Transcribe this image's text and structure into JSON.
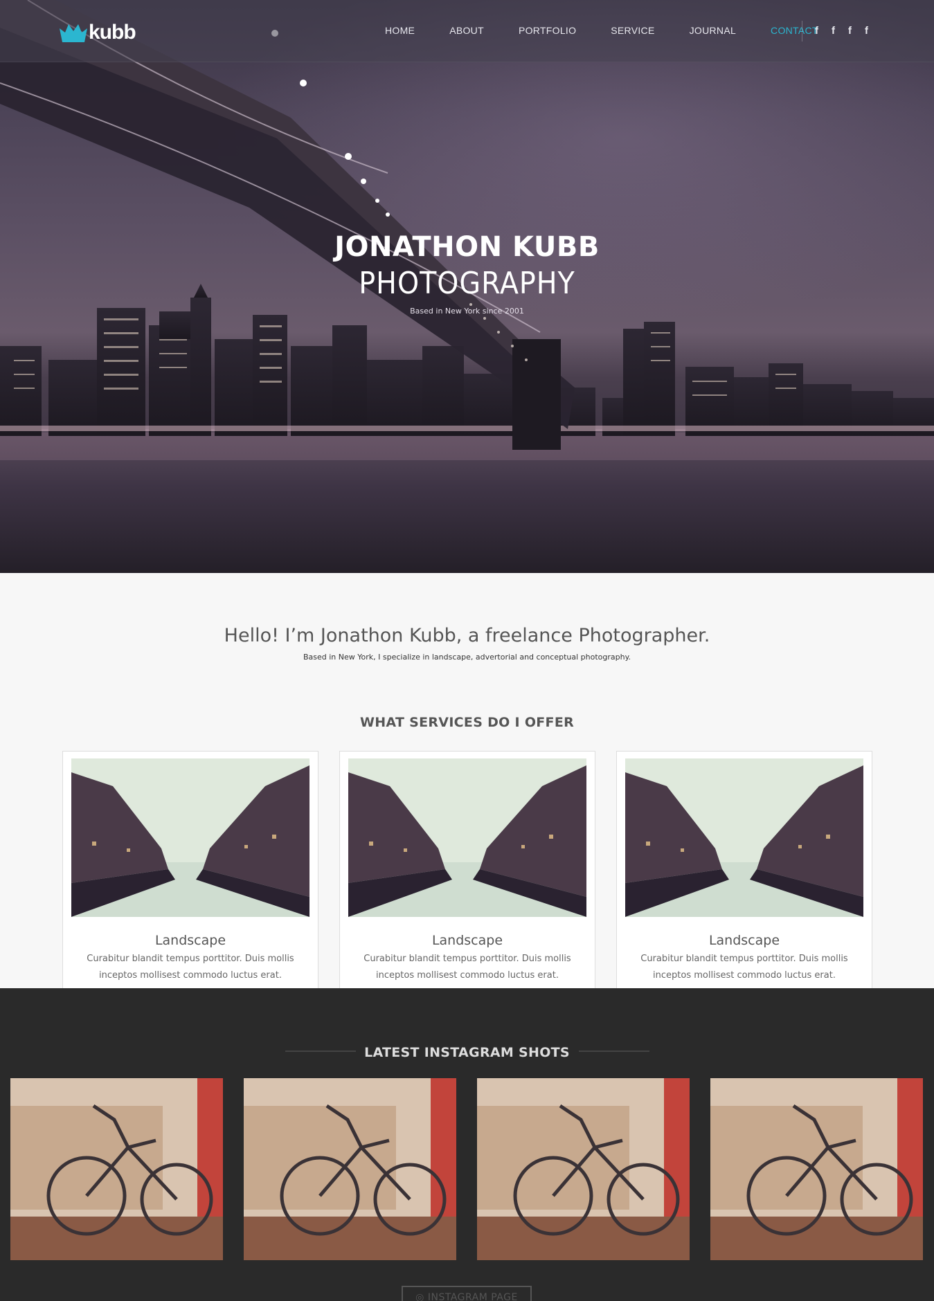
{
  "brand": {
    "logo_text": "kubb",
    "accent": "#2bb6d0"
  },
  "nav": {
    "items": [
      {
        "label": "HOME"
      },
      {
        "label": "ABOUT"
      },
      {
        "label": "PORTFOLIO"
      },
      {
        "label": "SERVICE"
      },
      {
        "label": "JOURNAL"
      },
      {
        "label": "CONTACT",
        "active": true
      }
    ],
    "socials": [
      "f",
      "f",
      "f",
      "f"
    ]
  },
  "hero": {
    "title": "JONATHON KUBB",
    "subtitle": "PHOTOGRAPHY",
    "tagline": "Based in New York since 2001"
  },
  "intro": {
    "heading": "Hello! I’m Jonathon Kubb, a freelance Photographer.",
    "text": "Based in New York, I specialize in landscape, advertorial and conceptual photography."
  },
  "services": {
    "title": "WHAT SERVICES DO I OFFER",
    "cards": [
      {
        "title": "Landscape",
        "text": "Curabitur blandit tempus porttitor. Duis mollis inceptos mollisest commodo luctus erat."
      },
      {
        "title": "Landscape",
        "text": "Curabitur blandit tempus porttitor. Duis mollis inceptos mollisest commodo luctus erat."
      },
      {
        "title": "Landscape",
        "text": "Curabitur blandit tempus porttitor. Duis mollis inceptos mollisest commodo luctus erat."
      }
    ]
  },
  "instagram": {
    "title": "LATEST INSTAGRAM SHOTS",
    "button": "INSTAGRAM PAGE"
  }
}
